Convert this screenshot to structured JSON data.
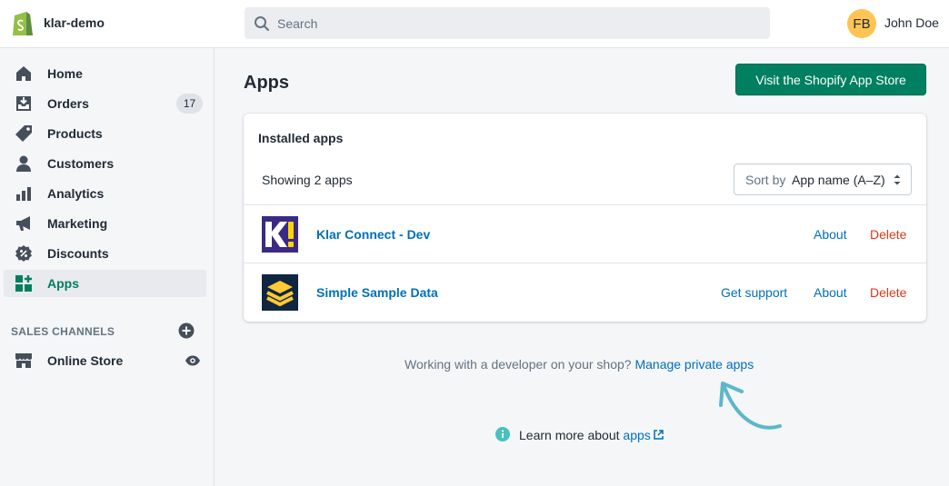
{
  "store": {
    "name": "klar-demo"
  },
  "search": {
    "placeholder": "Search"
  },
  "user": {
    "initials": "FB",
    "name": "John Doe"
  },
  "sidebar": {
    "items": [
      {
        "label": "Home",
        "icon": "home-icon"
      },
      {
        "label": "Orders",
        "icon": "orders-icon",
        "badge": "17"
      },
      {
        "label": "Products",
        "icon": "tag-icon"
      },
      {
        "label": "Customers",
        "icon": "person-icon"
      },
      {
        "label": "Analytics",
        "icon": "bar-chart-icon"
      },
      {
        "label": "Marketing",
        "icon": "megaphone-icon"
      },
      {
        "label": "Discounts",
        "icon": "discount-icon"
      },
      {
        "label": "Apps",
        "icon": "apps-icon",
        "active": true
      }
    ],
    "sales_channels_title": "SALES CHANNELS",
    "channels": [
      {
        "label": "Online Store",
        "icon": "store-icon"
      }
    ]
  },
  "main": {
    "title": "Apps",
    "store_button": "Visit the Shopify App Store",
    "card": {
      "title": "Installed apps",
      "count": "Showing 2 apps",
      "sort_prefix": "Sort by",
      "sort_value": "App name (A–Z)",
      "apps": [
        {
          "name": "Klar Connect - Dev",
          "actions": [
            "About",
            "Delete"
          ]
        },
        {
          "name": "Simple Sample Data",
          "actions": [
            "Get support",
            "About",
            "Delete"
          ]
        }
      ]
    },
    "developer_hint": "Working with a developer on your shop?",
    "developer_link": "Manage private apps",
    "learn_prefix": "Learn more about",
    "learn_link": "apps"
  },
  "colors": {
    "accent": "#008060",
    "link": "#006fbb",
    "danger": "#de3618",
    "avatar": "#ffc453",
    "arrow": "#5bb8c9"
  }
}
